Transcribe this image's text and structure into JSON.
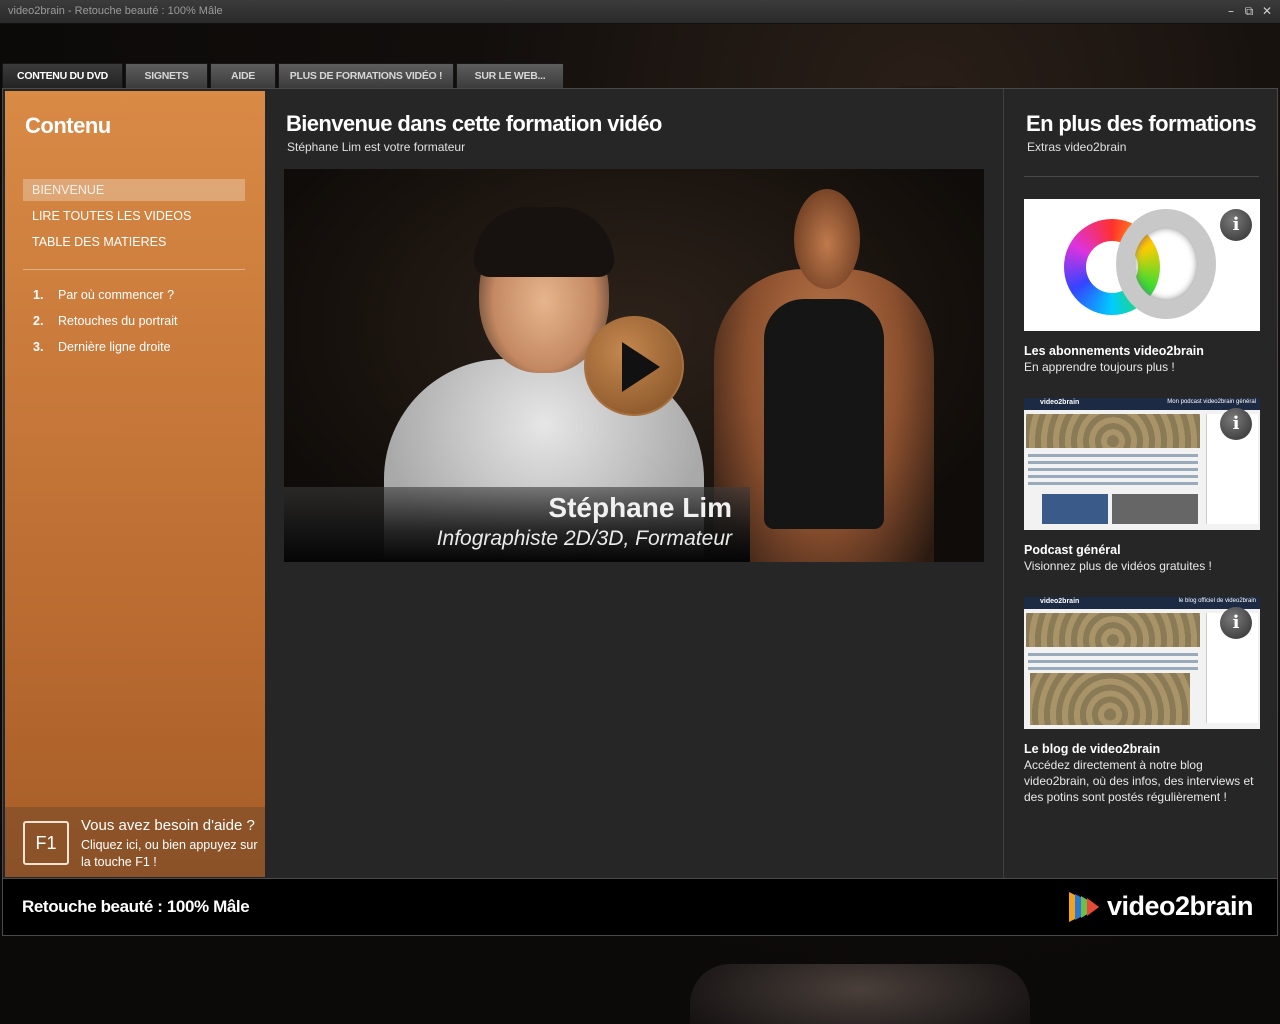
{
  "window": {
    "title": "video2brain - Retouche beauté : 100% Mâle"
  },
  "tabs": [
    {
      "label": "CONTENU DU DVD"
    },
    {
      "label": "SIGNETS"
    },
    {
      "label": "AIDE"
    },
    {
      "label": "PLUS DE FORMATIONS VIDÉO !"
    },
    {
      "label": "SUR LE WEB..."
    }
  ],
  "sidebar": {
    "title": "Contenu",
    "nav": [
      {
        "label": "BIENVENUE"
      },
      {
        "label": "LIRE TOUTES LES VIDEOS"
      },
      {
        "label": "TABLE DES MATIERES"
      }
    ],
    "chapters": [
      {
        "num": "1.",
        "label": "Par où commencer ?"
      },
      {
        "num": "2.",
        "label": "Retouches du portrait"
      },
      {
        "num": "3.",
        "label": "Dernière ligne droite"
      }
    ],
    "help": {
      "key": "F1",
      "title": "Vous avez besoin d'aide ?",
      "text": "Cliquez ici, ou bien appuyez sur la touche F1 !"
    }
  },
  "main": {
    "title": "Bienvenue dans cette formation vidéo",
    "subtitle": "Stéphane Lim est votre formateur",
    "video": {
      "name": "Stéphane Lim",
      "role": "Infographiste 2D/3D, Formateur"
    }
  },
  "extras": {
    "title": "En plus des formations",
    "subtitle": "Extras video2brain",
    "cards": [
      {
        "title": "Les abonnements video2brain",
        "text": "En apprendre toujours plus !"
      },
      {
        "title": "Podcast général",
        "text": "Visionnez plus de vidéos gratuites !",
        "thumb_brand": "video2brain",
        "thumb_header": "Mon podcast video2brain général"
      },
      {
        "title": "Le blog de video2brain",
        "text": "Accédez directement à notre blog video2brain, où des infos, des interviews et des potins sont postés régulièrement !",
        "thumb_brand": "video2brain",
        "thumb_header": "le blog officiel de video2brain"
      }
    ]
  },
  "footer": {
    "course": "Retouche beauté : 100% Mâle",
    "brand": "video2brain"
  },
  "icons": {
    "minimize": "minimize-icon",
    "maximize": "maximize-icon",
    "close": "close-icon",
    "play": "play-icon",
    "info": "info-icon"
  }
}
